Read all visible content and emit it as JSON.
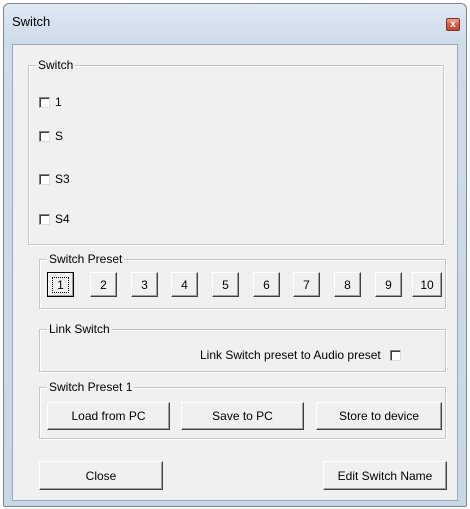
{
  "window": {
    "title": "Switch",
    "close_label": "x"
  },
  "switch_group": {
    "label": "Switch",
    "items": [
      {
        "label": "1",
        "checked": false
      },
      {
        "label": "S",
        "checked": false
      },
      {
        "label": "S3",
        "checked": false
      },
      {
        "label": "S4",
        "checked": false
      }
    ]
  },
  "preset_group": {
    "label": "Switch Preset",
    "buttons": [
      "1",
      "2",
      "3",
      "4",
      "5",
      "6",
      "7",
      "8",
      "9",
      "10"
    ],
    "selected": "1"
  },
  "link_group": {
    "label": "Link Switch",
    "checkbox_label": "Link Switch preset to Audio preset",
    "checked": false
  },
  "preset_file_group": {
    "label": "Switch Preset 1",
    "load_label": "Load from PC",
    "save_label": "Save to PC",
    "store_label": "Store to device"
  },
  "footer": {
    "close_label": "Close",
    "edit_label": "Edit Switch Name"
  }
}
